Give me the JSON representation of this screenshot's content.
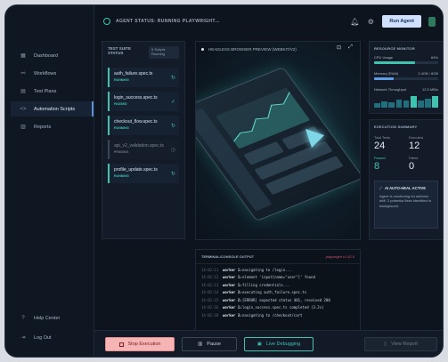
{
  "header": {
    "status": "AGENT STATUS: RUNNING PLAYWRIGHT...",
    "run_label": "Run Agent"
  },
  "sidebar": {
    "items": [
      {
        "label": "Dashboard",
        "icon": "grid-icon"
      },
      {
        "label": "Workflows",
        "icon": "workflow-icon"
      },
      {
        "label": "Test Plans",
        "icon": "clipboard-icon"
      },
      {
        "label": "Automation Scripts",
        "icon": "code-icon",
        "active": true
      },
      {
        "label": "Reports",
        "icon": "chart-icon"
      }
    ],
    "bottom": [
      {
        "label": "Help Center",
        "icon": "help-icon"
      },
      {
        "label": "Log Out",
        "icon": "logout-icon"
      }
    ]
  },
  "suite": {
    "title": "TEST SUITE STATUS",
    "badge": "5 Scripts Running",
    "specs": [
      {
        "name": "auth_failure.spec.ts",
        "status": "RUNNING"
      },
      {
        "name": "login_success.spec.ts",
        "status": "PASSED"
      },
      {
        "name": "checkout_flow.spec.ts",
        "status": "RUNNING"
      },
      {
        "name": "api_v2_validation.spec.ts",
        "status": "PENDING"
      },
      {
        "name": "profile_update.spec.ts",
        "status": "RUNNING"
      }
    ]
  },
  "preview": {
    "title": "HEADLESS BROWSER PREVIEW (WEBKIT/V2)"
  },
  "terminal": {
    "title": "TERMINAL/CONSOLE OUTPUT",
    "version": "playwright v1.42.0",
    "lines": [
      {
        "time": "14:02:11",
        "worker": "worker 1:",
        "msg": "navigating to /login..."
      },
      {
        "time": "14:02:12",
        "worker": "worker 1:",
        "msg": "element 'input[name=\"user\"]' found"
      },
      {
        "time": "14:02:13",
        "worker": "worker 1:",
        "msg": "filling credentials..."
      },
      {
        "time": "14:02:14",
        "worker": "worker 3:",
        "msg": "executing auth_failure.spec.ts"
      },
      {
        "time": "14:02:15",
        "worker": "worker 2:",
        "msg": "[ERROR] expected status 401, received 200"
      },
      {
        "time": "14:02:16",
        "worker": "worker 1:",
        "msg": "login_success.spec.ts completed (3.2s)"
      },
      {
        "time": "14:02:18",
        "worker": "worker 3:",
        "msg": "navigating to /checkout/cart"
      }
    ]
  },
  "resources": {
    "title": "RESOURCE MONITOR",
    "cpu_label": "CPU Usage",
    "cpu_value": "64%",
    "cpu_fraction": 0.64,
    "mem_label": "Memory (RAM)",
    "mem_value": "2.4GB / 8GB",
    "mem_fraction": 0.3,
    "net_label": "Network Throughput",
    "net_value": "12.5 MB/s",
    "net_history": [
      0.35,
      0.5,
      0.4,
      0.65,
      0.55,
      0.9,
      0.6,
      0.75,
      0.95
    ]
  },
  "execution": {
    "title": "EXECUTION SUMMARY",
    "total_label": "Total Tests",
    "total_value": "24",
    "executed_label": "Executed",
    "executed_value": "12",
    "passed_label": "Passed",
    "passed_value": "8",
    "failed_label": "Failed",
    "failed_value": "0",
    "heal_title": "AI AUTO-HEAL ACTIVE",
    "heal_text": "Agent is monitoring for selector drift. 2 potential fixes identified in background."
  },
  "footer": {
    "stop": "Stop Execution",
    "pause": "Pause",
    "live": "Live Debugging",
    "report": "View Report"
  },
  "colors": {
    "accent": "#3fc3b0",
    "background": "#0d141d",
    "stop": "#f6b4b4",
    "run": "#cfe0ff"
  }
}
